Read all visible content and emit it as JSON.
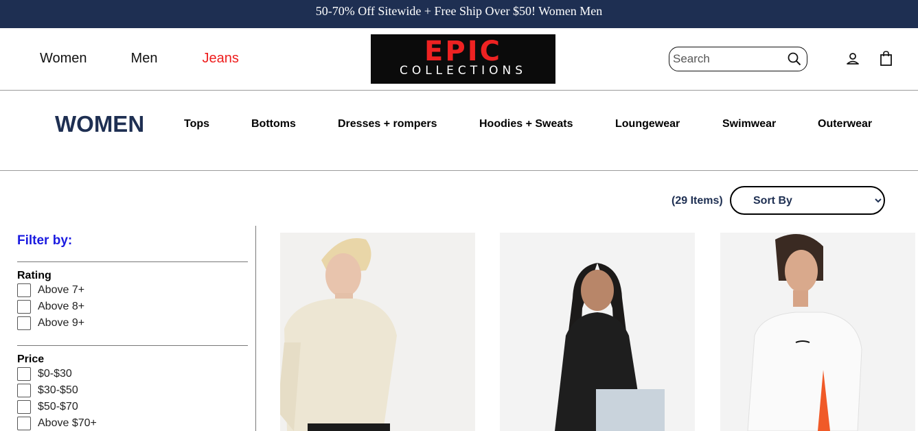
{
  "promo": {
    "text": "50-70% Off Sitewide + Free Ship Over $50! Women Men"
  },
  "nav": {
    "women": "Women",
    "men": "Men",
    "jeans": "Jeans"
  },
  "logo": {
    "line1": "EPIC",
    "line2": "COLLECTIONS"
  },
  "search": {
    "placeholder": "Search",
    "icon": "search-icon"
  },
  "header_icons": {
    "account": "user-icon",
    "cart": "shopping-bag-icon"
  },
  "subnav": {
    "title": "WOMEN",
    "categories": [
      "Tops",
      "Bottoms",
      "Dresses + rompers",
      "Hoodies + Sweats",
      "Loungewear",
      "Swimwear",
      "Outerwear"
    ]
  },
  "toolbar": {
    "items_count": "(29 Items)",
    "sort_selected": "Sort By"
  },
  "filters": {
    "title": "Filter by:",
    "rating": {
      "title": "Rating",
      "options": [
        "Above 7+",
        "Above 8+",
        "Above 9+"
      ]
    },
    "price": {
      "title": "Price",
      "options": [
        "$0-$30",
        "$30-$50",
        "$50-$70",
        "Above $70+"
      ]
    }
  },
  "colors": {
    "promo_bg": "#1e2f52",
    "accent_red": "#ee1c1c",
    "heading_navy": "#1e2f52",
    "filter_blue": "#1a1ae0"
  },
  "products": [
    {
      "image": "model-cream-high-neck-top"
    },
    {
      "image": "model-black-high-neck-top"
    },
    {
      "image": "model-white-tank-top"
    }
  ]
}
